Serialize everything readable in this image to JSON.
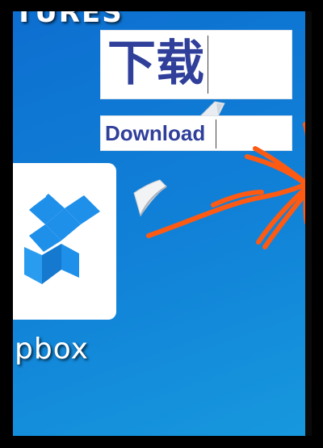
{
  "desktop": {
    "background": "#1182d8",
    "top_label": "TURES",
    "icon_label": "pbox",
    "app_icon": "dropbox-icon"
  },
  "annotation": {
    "chinese_text": "下载",
    "english_text": "Download",
    "text_color": "#2f3f9a",
    "arrow_color": "#ff5a12"
  }
}
